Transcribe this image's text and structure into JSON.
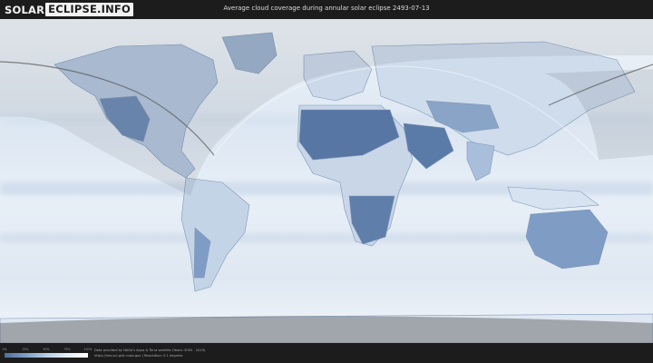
{
  "header": {
    "logo_part1": "SOLAR",
    "logo_part2": "ECLIPSE.INFO",
    "title": "Average cloud coverage during annular solar eclipse 2493-07-13"
  },
  "legend": {
    "ticks": [
      {
        "label": "0%",
        "value": 0
      },
      {
        "label": "25%",
        "value": 0.25
      },
      {
        "label": "50%",
        "value": 0.5
      },
      {
        "label": "75%",
        "value": 0.75
      },
      {
        "label": "100%",
        "value": 1
      }
    ],
    "colors": [
      "#4e6e9c",
      "#7d9cc6",
      "#b7cce4",
      "#e4edf7",
      "#ffffff"
    ]
  },
  "footer": {
    "credit_line1": "Data provided by NASA's Aqua & Terra satellite (Years: 2000 - 2019)",
    "credit_line2": "https://neo.sci.gsfc.nasa.gov | Resolution: 0.1 degrees"
  },
  "colors": {
    "ocean_cloudy": "#eef3f9",
    "land_clear": "#5a7aa8",
    "shadow": "#2a2a2a",
    "eclipse_path": "#555555"
  }
}
